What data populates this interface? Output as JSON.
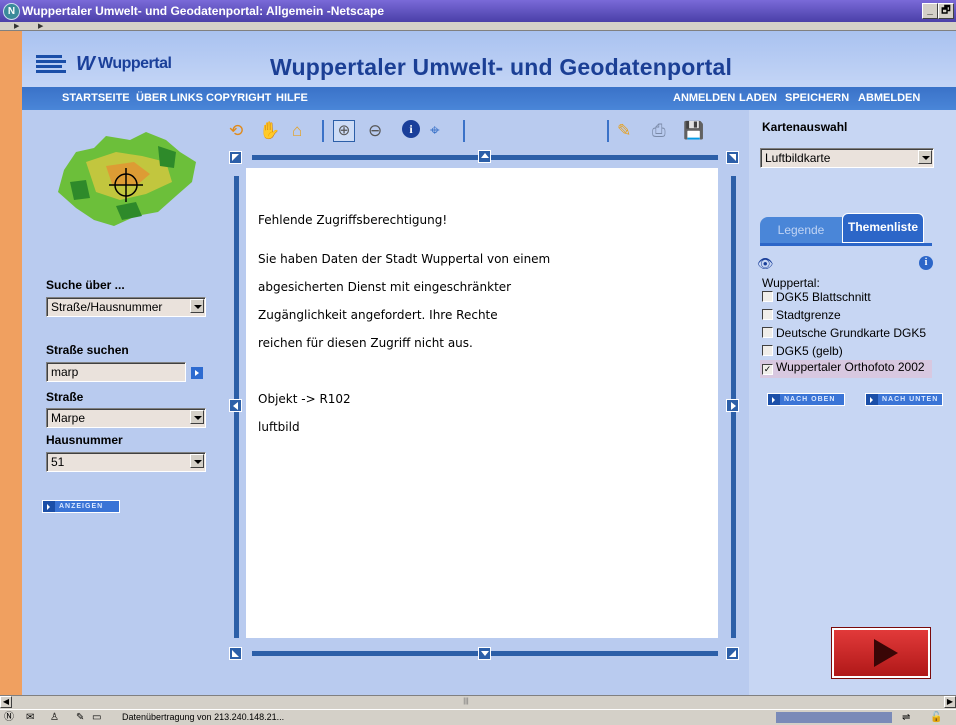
{
  "window": {
    "title": "Wuppertaler Umwelt- und Geodatenportal: Allgemein -Netscape",
    "controls": [
      "_",
      "🗗"
    ]
  },
  "header": {
    "logo_text": "Wuppertal",
    "portal_title": "Wuppertaler Umwelt- und Geodatenportal"
  },
  "nav": {
    "left": [
      "STARTSEITE",
      "ÜBER",
      "LINKS",
      "COPYRIGHT",
      "HILFE"
    ],
    "right": [
      "ANMELDEN",
      "LADEN",
      "SPEICHERN",
      "ABMELDEN"
    ]
  },
  "search": {
    "suche_ueber_label": "Suche über ...",
    "suche_ueber_value": "Straße/Hausnummer",
    "strasse_suchen_label": "Straße suchen",
    "strasse_suchen_value": "marp",
    "strasse_label": "Straße",
    "strasse_value": "Marpe",
    "hausnummer_label": "Hausnummer",
    "hausnummer_value": "51",
    "anzeigen_label": "ANZEIGEN"
  },
  "toolbar": {
    "icons": [
      "refresh-icon",
      "hand-pan-icon",
      "home-icon",
      "zoom-in-icon",
      "zoom-out-icon",
      "info-icon",
      "crosshair-icon",
      "pencil-icon",
      "print-icon",
      "save-icon"
    ]
  },
  "map_message": {
    "line1": "Fehlende Zugriffsberechtigung!",
    "line2": "Sie haben Daten der Stadt Wuppertal von einem",
    "line3": "abgesicherten Dienst mit eingeschränkter",
    "line4": "Zugänglichkeit angefordert. Ihre Rechte",
    "line5": "reichen für diesen Zugriff nicht aus.",
    "line6": "Objekt -> R102",
    "line7": "luftbild"
  },
  "right": {
    "kartenauswahl_label": "Kartenauswahl",
    "kartenauswahl_value": "Luftbildkarte",
    "tab_legende": "Legende",
    "tab_themenliste": "Themenliste",
    "group_label": "Wuppertal:",
    "layers": [
      {
        "label": "DGK5 Blattschnitt",
        "checked": false
      },
      {
        "label": "Stadtgrenze",
        "checked": false
      },
      {
        "label": "Deutsche Grundkarte DGK5",
        "checked": false
      },
      {
        "label": "DGK5 (gelb)",
        "checked": false
      },
      {
        "label": "Wuppertaler Orthofoto 2002",
        "checked": true
      }
    ],
    "nach_oben": "NACH OBEN",
    "nach_unten": "NACH UNTEN"
  },
  "status": {
    "text": "Datenübertragung von 213.240.148.21..."
  },
  "colors": {
    "accent": "#2c5fa8",
    "nav": "#3a72c8",
    "orange": "#f0a060",
    "play": "#cc2222"
  }
}
